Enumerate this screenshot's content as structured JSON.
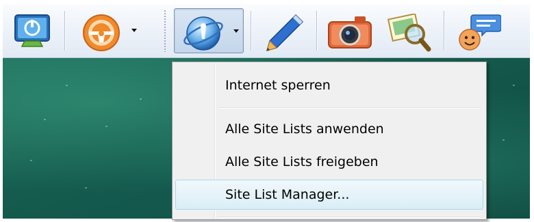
{
  "toolbar": {
    "buttons": [
      {
        "icon": "monitor-power-icon"
      },
      {
        "icon": "steering-wheel-icon",
        "has_dropdown": true
      },
      {
        "icon": "internet-globe-icon",
        "has_dropdown": true,
        "pressed": true
      },
      {
        "icon": "pen-icon"
      },
      {
        "icon": "camera-icon"
      },
      {
        "icon": "picture-search-icon"
      },
      {
        "icon": "chat-user-icon"
      }
    ]
  },
  "menu": {
    "items": [
      {
        "label": "Internet sperren"
      },
      {
        "label": "Alle Site Lists anwenden"
      },
      {
        "label": "Alle Site Lists freigeben"
      },
      {
        "label": "Site List Manager...",
        "highlighted": true
      }
    ]
  },
  "colors": {
    "toolbar_bg": "#eef3f9",
    "menu_bg": "#f0f0f0",
    "menu_highlight": "#d9eef7",
    "desktop_green": "#145a4c"
  }
}
